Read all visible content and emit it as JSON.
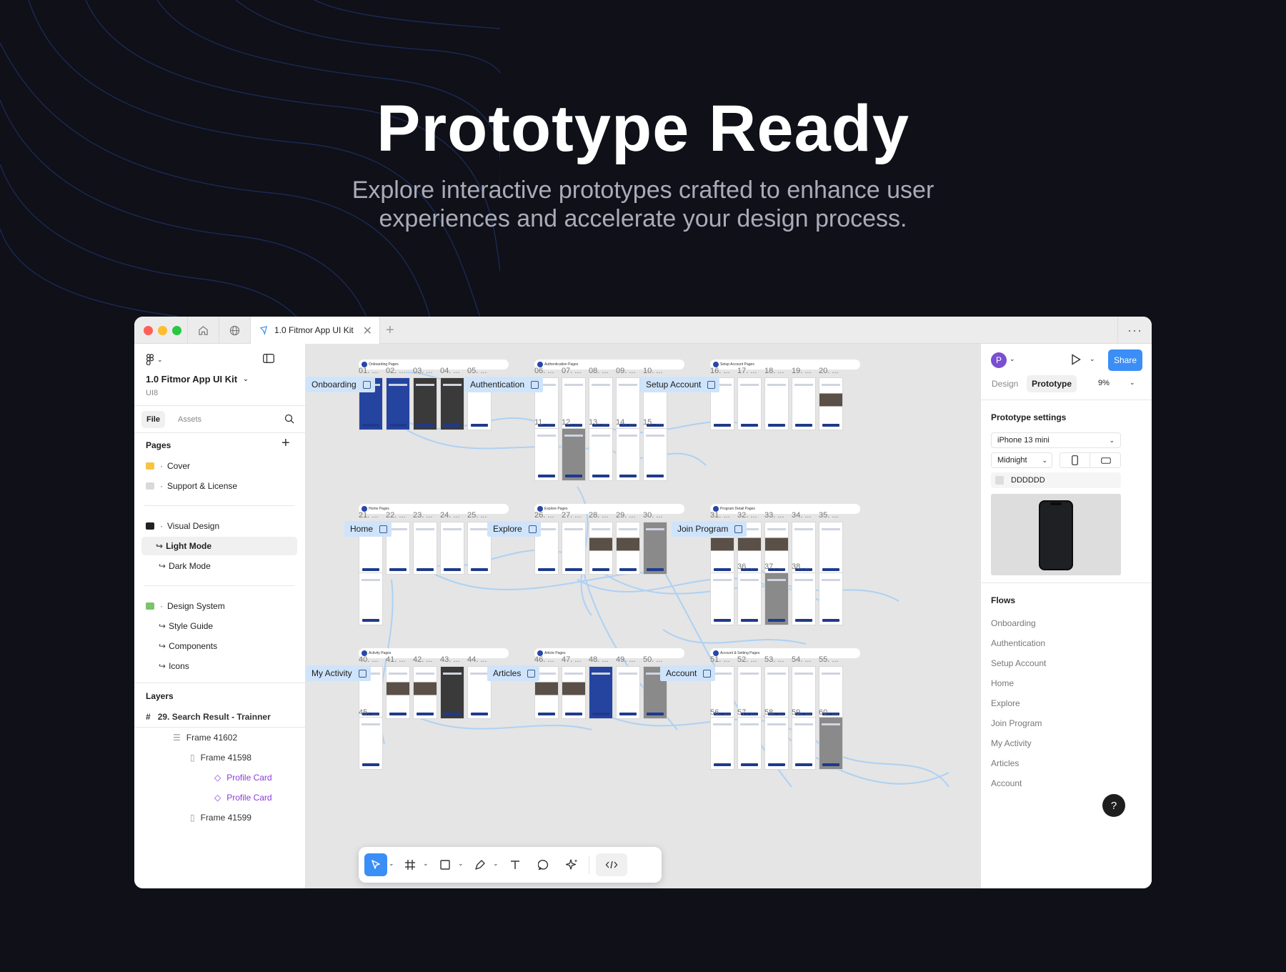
{
  "hero": {
    "title": "Prototype Ready",
    "subtitle": "Explore interactive prototypes crafted to enhance user experiences and accelerate your design process."
  },
  "titlebar": {
    "tab_title": "1.0 Fitmor App UI Kit",
    "more": "···"
  },
  "left_panel": {
    "file_name": "1.0 Fitmor App UI Kit",
    "team": "UI8",
    "tabs": [
      "File",
      "Assets"
    ],
    "pages_heading": "Pages",
    "pages": [
      {
        "label": "Cover"
      },
      {
        "label": "Support & License"
      },
      {
        "label": "Visual Design"
      },
      {
        "label": "Light Mode"
      },
      {
        "label": "Dark Mode"
      },
      {
        "label": "Design System"
      },
      {
        "label": "Style Guide"
      },
      {
        "label": "Components"
      },
      {
        "label": "Icons"
      }
    ],
    "layers_heading": "Layers",
    "layers": [
      {
        "label": "29. Search Result - Trainner"
      },
      {
        "label": "Frame 41602"
      },
      {
        "label": "Frame 41598"
      },
      {
        "label": "Profile Card"
      },
      {
        "label": "Profile Card"
      },
      {
        "label": "Frame 41599"
      }
    ]
  },
  "canvas": {
    "sections": [
      "Onboarding Pages",
      "Authentication Pages",
      "Setup Account Pages",
      "Home Pages",
      "Explore Pages",
      "Program Detail Pages",
      "Activity Pages",
      "Article Pages",
      "Account & Setting Pages"
    ],
    "flow_labels": [
      "Onboarding",
      "Authentication",
      "Setup Account",
      "Home",
      "Explore",
      "Join Program",
      "My Activity",
      "Articles",
      "Account"
    ],
    "row1_numbers": [
      "01. ...",
      "02. ...",
      "03. ...",
      "04. ...",
      "05. ...",
      "06. ...",
      "07. ...",
      "08. ...",
      "09. ...",
      "10. ...",
      "16. ...",
      "17. ...",
      "18. ...",
      "19. ...",
      "20. ..."
    ],
    "row1b_numbers": [
      "11. ...",
      "12. ...",
      "13. ...",
      "14. ...",
      "15. ..."
    ],
    "row2_numbers": [
      "21. ...",
      "22. ...",
      "23. ...",
      "24. ...",
      "25. ...",
      "26. ...",
      "27. ...",
      "28. ...",
      "29. ...",
      "30. ...",
      "31. ...",
      "32. ...",
      "33. ...",
      "34. ...",
      "35. ..."
    ],
    "row2b_numbers": [
      "36. ...",
      "37. ...",
      "38. ..."
    ],
    "row3_numbers": [
      "40. ...",
      "41. ...",
      "42. ...",
      "43. ...",
      "44. ...",
      "46. ...",
      "47. ...",
      "48. ...",
      "49. ...",
      "50. ...",
      "51. ...",
      "52. ...",
      "53. ...",
      "54. ...",
      "55. ..."
    ],
    "row3b_numbers": [
      "45. ...",
      "56. ...",
      "57. ...",
      "58. ...",
      "59. ...",
      "60. ..."
    ]
  },
  "right_panel": {
    "avatar_letter": "P",
    "share_label": "Share",
    "tabs": [
      "Design",
      "Prototype"
    ],
    "zoom": "9%",
    "settings_heading": "Prototype settings",
    "device": "iPhone 13 mini",
    "device_color": "Midnight",
    "background_hex": "DDDDDD",
    "flows_heading": "Flows",
    "flows": [
      "Onboarding",
      "Authentication",
      "Setup Account",
      "Home",
      "Explore",
      "Join Program",
      "My Activity",
      "Articles",
      "Account"
    ],
    "help": "?"
  },
  "colors": {
    "accent": "#3a8ef6",
    "brand_blue": "#2544a0",
    "component_purple": "#8b3dd6",
    "background": "#0f1018"
  }
}
